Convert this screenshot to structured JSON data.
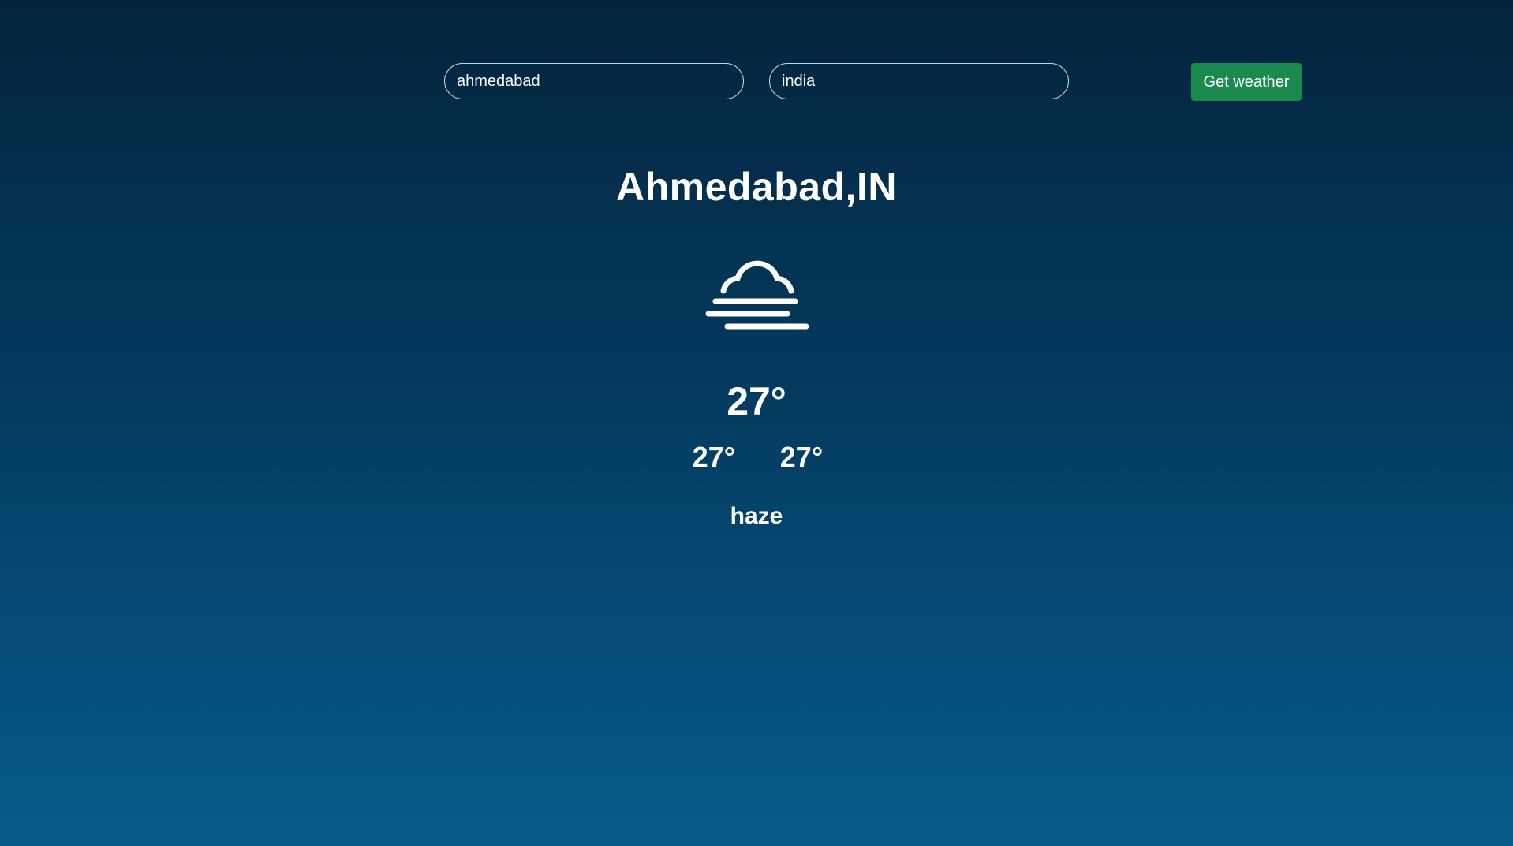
{
  "search": {
    "city_value": "ahmedabad",
    "country_value": "india",
    "button_label": "Get weather"
  },
  "weather": {
    "location": "Ahmedabad,IN",
    "icon": "haze-icon",
    "temperature": "27°",
    "temp_min": "27°",
    "temp_max": "27°",
    "description": "haze"
  },
  "colors": {
    "background_top": "#03243d",
    "background_bottom": "#065b8c",
    "button": "#1a8a4f",
    "text": "#ffffff"
  }
}
